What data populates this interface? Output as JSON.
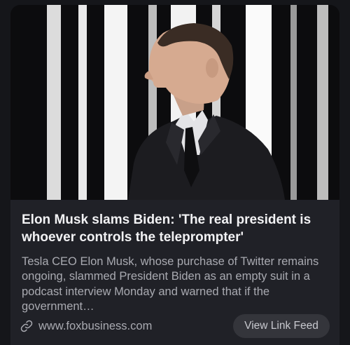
{
  "article": {
    "headline": "Elon Musk slams Biden: 'The real president is whoever controls the teleprompter'",
    "summary": "Tesla CEO Elon Musk, whose purchase of Twitter remains ongoing, slammed President Biden as an empty suit in a podcast interview Monday and warned that if the government…",
    "source_domain": "www.foxbusiness.com",
    "view_feed_label": "View Link Feed",
    "image_subject": "photo of a man in a dark suit in profile against a black-and-white striped backdrop",
    "icons": {
      "source": "link-icon"
    }
  },
  "colors": {
    "background": "#15161a",
    "card": "#202127",
    "headline": "#f2f2f4",
    "secondary_text": "#a9aab1",
    "button": "#34353b"
  }
}
